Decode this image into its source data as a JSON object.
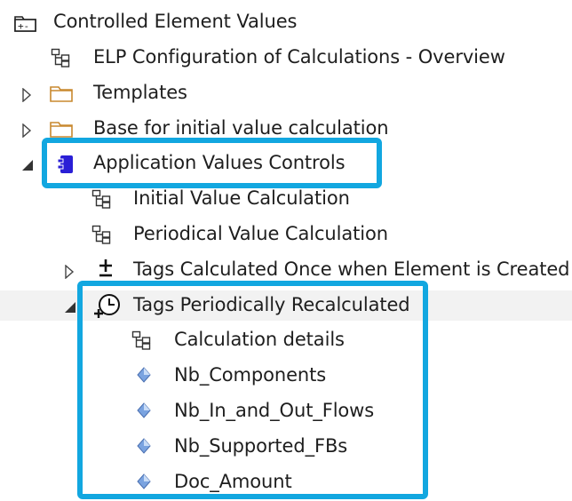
{
  "tree": {
    "root": {
      "label": "Controlled Element Values",
      "icon": "package-folder-icon",
      "expanded": true
    },
    "items": [
      {
        "label": "ELP Configuration of Calculations - Overview",
        "icon": "diagram-icon"
      },
      {
        "label": "Templates",
        "icon": "folder-icon",
        "expander": "collapsed"
      },
      {
        "label": "Base for initial value calculation",
        "icon": "folder-icon",
        "expander": "collapsed"
      },
      {
        "label": "Application Values Controls",
        "icon": "component-icon",
        "expander": "expanded",
        "highlight_color": "#12a7e0",
        "accent_color": "#2a1fd6",
        "children": [
          {
            "label": "Initial Value Calculation",
            "icon": "diagram-icon"
          },
          {
            "label": "Periodical Value Calculation",
            "icon": "diagram-icon"
          },
          {
            "label": "Tags Calculated Once when Element is Created",
            "icon": "plus-icon",
            "expander": "collapsed"
          },
          {
            "label": "Tags Periodically Recalculated",
            "icon": "clock-plus-icon",
            "expander": "expanded",
            "selected": true,
            "highlight_color": "#12a7e0",
            "children": [
              {
                "label": "Calculation details",
                "icon": "diagram-icon"
              },
              {
                "label": "Nb_Components",
                "icon": "attribute-diamond-icon"
              },
              {
                "label": "Nb_In_and_Out_Flows",
                "icon": "attribute-diamond-icon"
              },
              {
                "label": "Nb_Supported_FBs",
                "icon": "attribute-diamond-icon"
              },
              {
                "label": "Doc_Amount",
                "icon": "attribute-diamond-icon"
              }
            ]
          }
        ]
      }
    ]
  }
}
